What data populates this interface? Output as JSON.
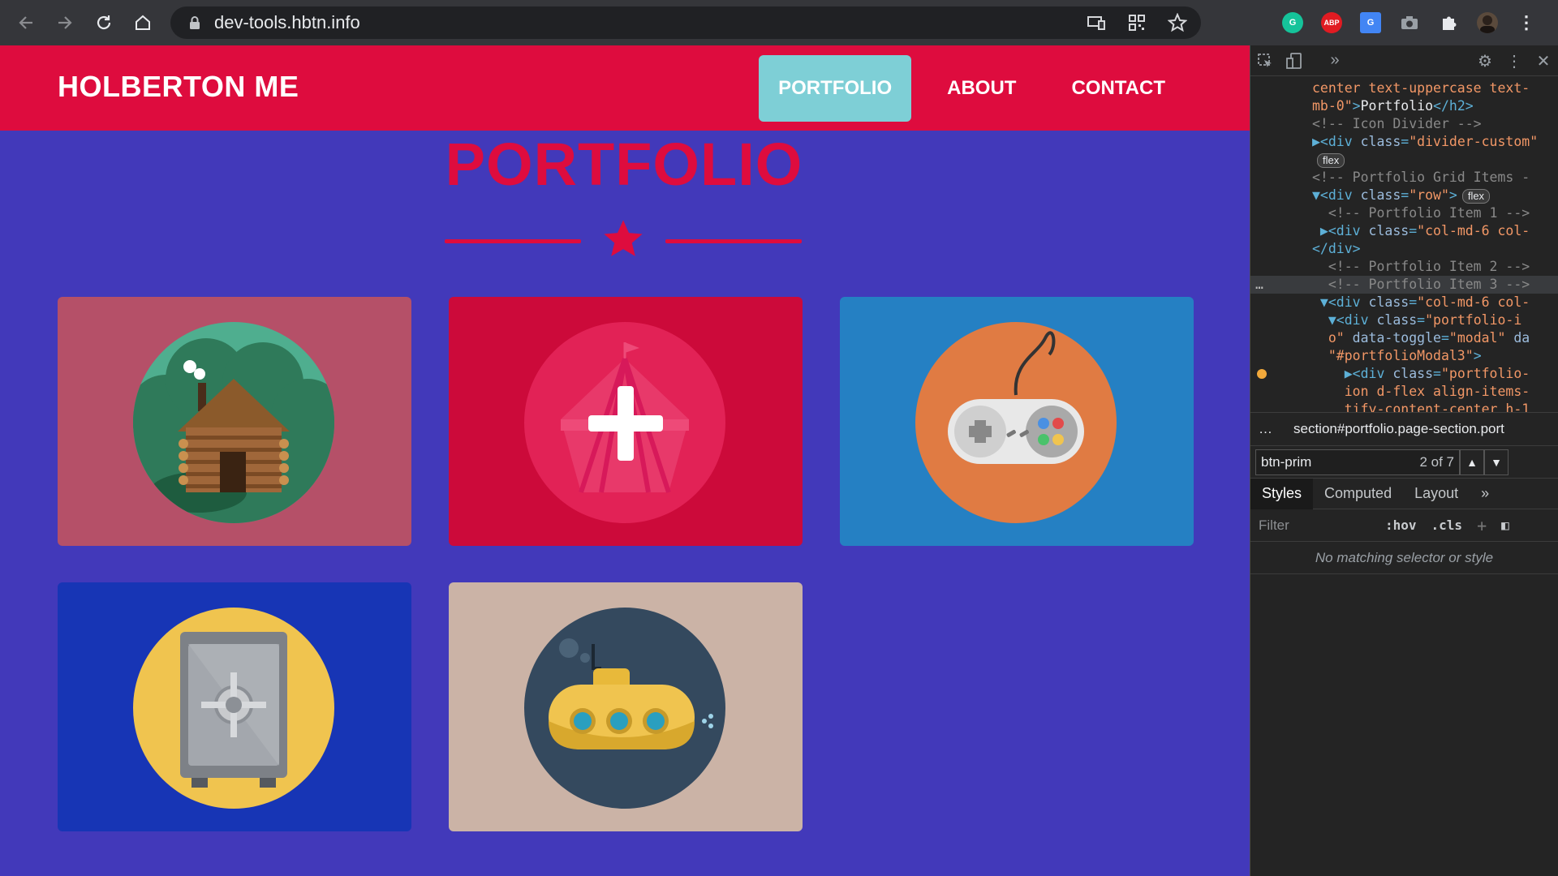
{
  "browser": {
    "url": "dev-tools.hbtn.info",
    "back_icon": "arrow-left-icon",
    "forward_icon": "arrow-right-icon",
    "reload_icon": "reload-icon",
    "home_icon": "home-icon",
    "extensions": [
      {
        "name": "grammarly",
        "label": "G",
        "color": "#15c39a"
      },
      {
        "name": "adblock-plus",
        "label": "ABP",
        "color": "#e11b22"
      },
      {
        "name": "google-translate",
        "label": "G",
        "color": "#4285f4"
      }
    ]
  },
  "site": {
    "brand": "HOLBERTON ME",
    "nav": [
      {
        "label": "PORTFOLIO",
        "active": true
      },
      {
        "label": "ABOUT",
        "active": false
      },
      {
        "label": "CONTACT",
        "active": false
      }
    ],
    "section_title": "PORTFOLIO",
    "colors": {
      "nav_bg": "#de0c3e",
      "page_bg": "#4239ba",
      "active_link_bg": "#7ecfd6"
    },
    "portfolio_items": [
      {
        "image": "cabin",
        "bg": "#b55068",
        "circle": "#4fae8f"
      },
      {
        "image": "circus-tent",
        "bg": "#cc0a3a",
        "circle": "#e22256",
        "hover": true
      },
      {
        "image": "game-controller",
        "bg": "#2580c3",
        "circle": "#e07b43"
      },
      {
        "image": "safe",
        "bg": "#1735b5",
        "circle": "#f0c44f"
      },
      {
        "image": "submarine",
        "bg": "#cbb3a6",
        "circle": "#34495e"
      }
    ]
  },
  "devtools": {
    "code_lines": [
      {
        "parts": [
          [
            "val",
            "center text-uppercase text-"
          ]
        ]
      },
      {
        "parts": [
          [
            "val",
            "mb-0\""
          ],
          [
            "tag",
            ">"
          ],
          [
            "txt",
            "Portfolio"
          ],
          [
            "tag",
            "</h2>"
          ]
        ]
      },
      {
        "parts": [
          [
            "cmt",
            "<!-- Icon Divider -->"
          ]
        ]
      },
      {
        "parts": [
          [
            "tag",
            "▶<div "
          ],
          [
            "attr",
            "class"
          ],
          [
            "tag",
            "="
          ],
          [
            "val",
            "\"divider-custom\""
          ]
        ]
      },
      {
        "badge": "flex"
      },
      {
        "parts": [
          [
            "cmt",
            "<!-- Portfolio Grid Items -"
          ]
        ]
      },
      {
        "parts": [
          [
            "tag",
            "▼<div "
          ],
          [
            "attr",
            "class"
          ],
          [
            "tag",
            "="
          ],
          [
            "val",
            "\"row\""
          ],
          [
            "tag",
            ">"
          ]
        ],
        "badge": "flex"
      },
      {
        "parts": [
          [
            "cmt",
            "  <!-- Portfolio Item 1 -->"
          ]
        ]
      },
      {
        "parts": [
          [
            "tag",
            " ▶<div "
          ],
          [
            "attr",
            "class"
          ],
          [
            "tag",
            "="
          ],
          [
            "val",
            "\"col-md-6 col-"
          ]
        ]
      },
      {
        "parts": [
          [
            "tag",
            "</div>"
          ]
        ]
      },
      {
        "parts": [
          [
            "cmt",
            "  <!-- Portfolio Item 2 -->"
          ]
        ]
      },
      {
        "parts": [
          [
            "cmt",
            "  <!-- Portfolio Item 3 -->"
          ]
        ],
        "selected": true
      },
      {
        "parts": [
          [
            "tag",
            " ▼<div "
          ],
          [
            "attr",
            "class"
          ],
          [
            "tag",
            "="
          ],
          [
            "val",
            "\"col-md-6 col-"
          ]
        ]
      },
      {
        "parts": [
          [
            "tag",
            "  ▼<div "
          ],
          [
            "attr",
            "class"
          ],
          [
            "tag",
            "="
          ],
          [
            "val",
            "\"portfolio-i"
          ]
        ]
      },
      {
        "parts": [
          [
            "val",
            "  o\" "
          ],
          [
            "attr",
            "data-toggle"
          ],
          [
            "tag",
            "="
          ],
          [
            "val",
            "\"modal\" "
          ],
          [
            "attr",
            "da"
          ]
        ]
      },
      {
        "parts": [
          [
            "val",
            "  \"#portfolioModal3\""
          ],
          [
            "tag",
            ">"
          ]
        ]
      },
      {
        "parts": [
          [
            "tag",
            "    ▶<div "
          ],
          [
            "attr",
            "class"
          ],
          [
            "tag",
            "="
          ],
          [
            "val",
            "\"portfolio-"
          ]
        ],
        "dot": true
      },
      {
        "parts": [
          [
            "val",
            "    ion d-flex align-items-"
          ]
        ]
      },
      {
        "parts": [
          [
            "val",
            "    tify-content-center h-1"
          ]
        ]
      }
    ],
    "breadcrumb": "section#portfolio.page-section.port",
    "search": {
      "value": "btn-prim",
      "count": "2 of 7"
    },
    "tabs": [
      "Styles",
      "Computed",
      "Layout"
    ],
    "filter_placeholder": "Filter",
    "hov": ":hov",
    "cls": ".cls",
    "no_match": "No matching selector or style"
  }
}
